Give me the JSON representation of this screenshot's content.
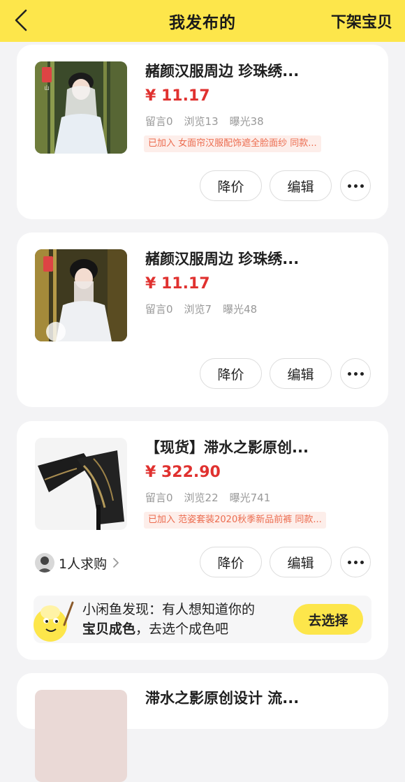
{
  "header": {
    "title": "我发布的",
    "action": "下架宝贝"
  },
  "colors": {
    "header_bg": "#fde64b",
    "price": "#e0312f",
    "tag_text": "#ec6c4f",
    "tag_bg": "#fdeeea",
    "page_bg": "#f3f3f5"
  },
  "items": [
    {
      "title": "赭颜汉服周边 珍珠绣...",
      "price": "¥ 11.17",
      "comments": "留言0",
      "views": "浏览13",
      "exposure": "曝光38",
      "tag": "已加入 女面帘汉服配饰遮全脸面纱 同款...",
      "btn_price": "降价",
      "btn_edit": "编辑"
    },
    {
      "title": "赭颜汉服周边 珍珠绣...",
      "price": "¥ 11.17",
      "comments": "留言0",
      "views": "浏览7",
      "exposure": "曝光48",
      "btn_price": "降价",
      "btn_edit": "编辑"
    },
    {
      "title": "【现货】滞水之影原创...",
      "price": "¥ 322.90",
      "comments": "留言0",
      "views": "浏览22",
      "exposure": "曝光741",
      "tag": "已加入 范姿套装2020秋季新品前裤 同款...",
      "want": "1人求购",
      "btn_price": "降价",
      "btn_edit": "编辑",
      "tip": {
        "line1": "小闲鱼发现：有人想知道你的",
        "bold": "宝贝成色",
        "line2_rest": "，去选个成色吧",
        "button": "去选择"
      }
    },
    {
      "title": "滞水之影原创设计 流..."
    }
  ]
}
